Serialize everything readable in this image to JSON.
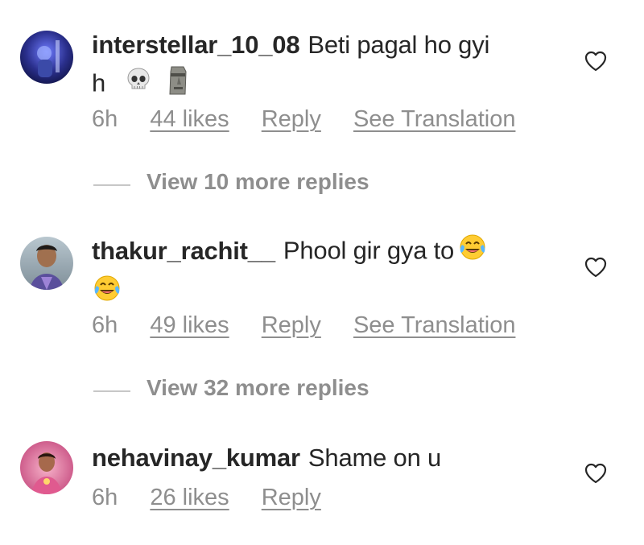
{
  "comments": [
    {
      "username": "interstellar_10_08",
      "text_line1": "Beti pagal ho gyi",
      "text_line2": "h",
      "emojis": [
        "skull-emoji",
        "moai-emoji"
      ],
      "time": "6h",
      "likes": "44 likes",
      "reply": "Reply",
      "translate": "See Translation",
      "view_more": "View 10 more replies"
    },
    {
      "username": "thakur_rachit__",
      "text_line1": "Phool gir gya to",
      "text_line2": "",
      "emojis": [
        "tears-of-joy-emoji",
        "tears-of-joy-emoji"
      ],
      "time": "6h",
      "likes": "49 likes",
      "reply": "Reply",
      "translate": "See Translation",
      "view_more": "View 32 more replies"
    },
    {
      "username": "nehavinay_kumar",
      "text_line1": "Shame on u",
      "time": "6h",
      "likes": "26 likes",
      "reply": "Reply"
    }
  ],
  "colors": {
    "text": "#262626",
    "secondary": "#8e8e8e",
    "divider": "#c7c7c7"
  }
}
